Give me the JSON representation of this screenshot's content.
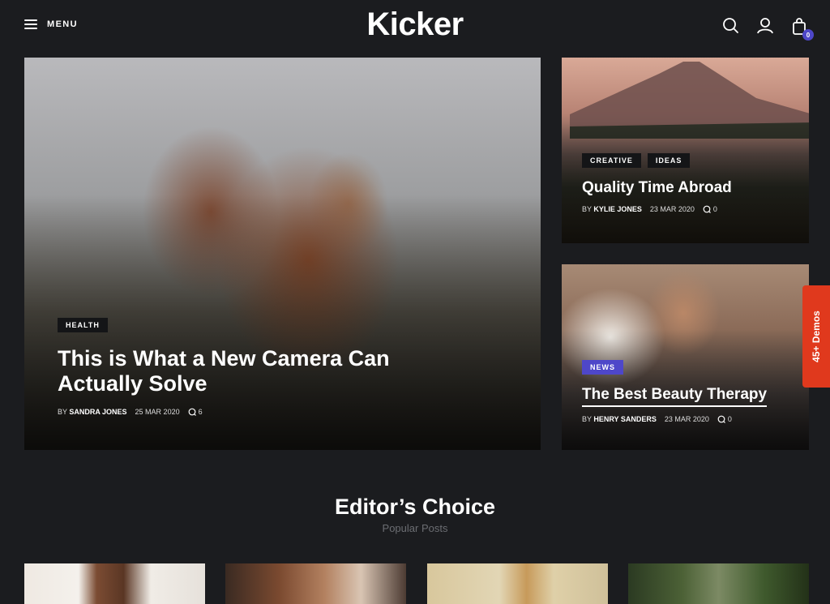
{
  "header": {
    "menu_label": "MENU",
    "logo": "Kicker",
    "cart_count": "0",
    "icons": [
      "search-icon",
      "user-icon",
      "bag-icon"
    ]
  },
  "featured": {
    "main": {
      "tags": [
        "HEALTH"
      ],
      "title": "This is What a New Camera Can Actually Solve",
      "by_prefix": "BY",
      "author": "SANDRA JONES",
      "date": "25 MAR 2020",
      "comments": "6"
    },
    "side_top": {
      "tags": [
        "CREATIVE",
        "IDEAS"
      ],
      "title": "Quality Time Abroad",
      "by_prefix": "BY",
      "author": "KYLIE JONES",
      "date": "23 MAR 2020",
      "comments": "0"
    },
    "side_bottom": {
      "tags": [
        "NEWS"
      ],
      "title": "The Best Beauty Therapy",
      "by_prefix": "BY",
      "author": "HENRY SANDERS",
      "date": "23 MAR 2020",
      "comments": "0"
    }
  },
  "demos_tab": "45+ Demos",
  "editors_choice": {
    "title": "Editor’s Choice",
    "subtitle": "Popular Posts"
  },
  "colors": {
    "background": "#1b1c1f",
    "accent": "#4e47c9",
    "demos": "#e0391d"
  }
}
